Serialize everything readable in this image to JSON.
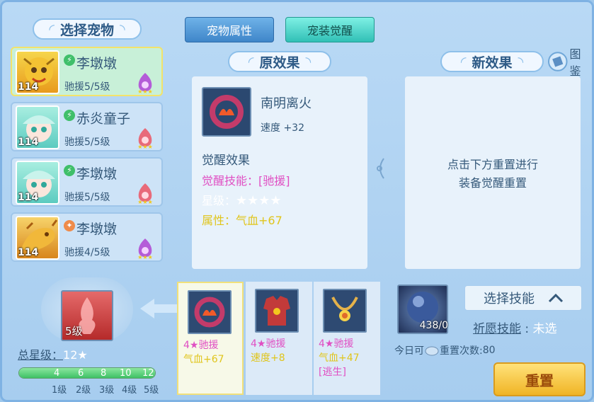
{
  "left": {
    "title": "选择宠物",
    "pets": [
      {
        "name": "李墩墩",
        "level": "114",
        "sub": "驰援5/5级",
        "elem": "⚡"
      },
      {
        "name": "赤炎童子",
        "level": "114",
        "sub": "驰援5/5级",
        "elem": "⚡"
      },
      {
        "name": "李墩墩",
        "level": "114",
        "sub": "驰援5/5级",
        "elem": "⚡"
      },
      {
        "name": "李墩墩",
        "level": "114",
        "sub": "驰援4/5级",
        "elem": "✦"
      }
    ]
  },
  "tabs": {
    "attr": "宠物属性",
    "awaken": "宠装觉醒"
  },
  "orig": {
    "title": "原效果",
    "item_name": "南明离火",
    "item_stat": "速度 +32",
    "awaken_title": "觉醒效果",
    "skill_label": "觉醒技能：",
    "skill_value": "[驰援]",
    "star_label": "星级：",
    "stars": "★★★★",
    "attr_label": "属性：",
    "attr_value": "气血+67"
  },
  "new": {
    "title": "新效果",
    "guide": "图鉴",
    "hint1": "点击下方重置进行",
    "hint2": "装备觉醒重置"
  },
  "bottom": {
    "slot_level": "5级",
    "total_label": "总星级：",
    "total_value": "12",
    "total_star": "★",
    "ticks": [
      "4",
      "6",
      "8",
      "10",
      "12"
    ],
    "levels": [
      "1级",
      "2级",
      "3级",
      "4级",
      "5级"
    ],
    "progress": 1.0
  },
  "items": [
    {
      "t1": "4★驰援",
      "t2": "气血+67",
      "t3": ""
    },
    {
      "t1": "4★驰援",
      "t2": "速度+8",
      "t3": ""
    },
    {
      "t1": "4★驰援",
      "t2": "气血+47",
      "t3": "[逃生]"
    }
  ],
  "right": {
    "orb_count": "438/0",
    "select_skill": "选择技能",
    "pray_label": "祈愿技能",
    "pray_value": "未选",
    "today_label": "今日可",
    "reset_count_label": "重置次数:",
    "reset_count": "80",
    "reset_button": "重置"
  },
  "colors": {
    "pink": "#e04fc3",
    "yellow": "#e0c51c",
    "blue_text": "#35597a"
  }
}
